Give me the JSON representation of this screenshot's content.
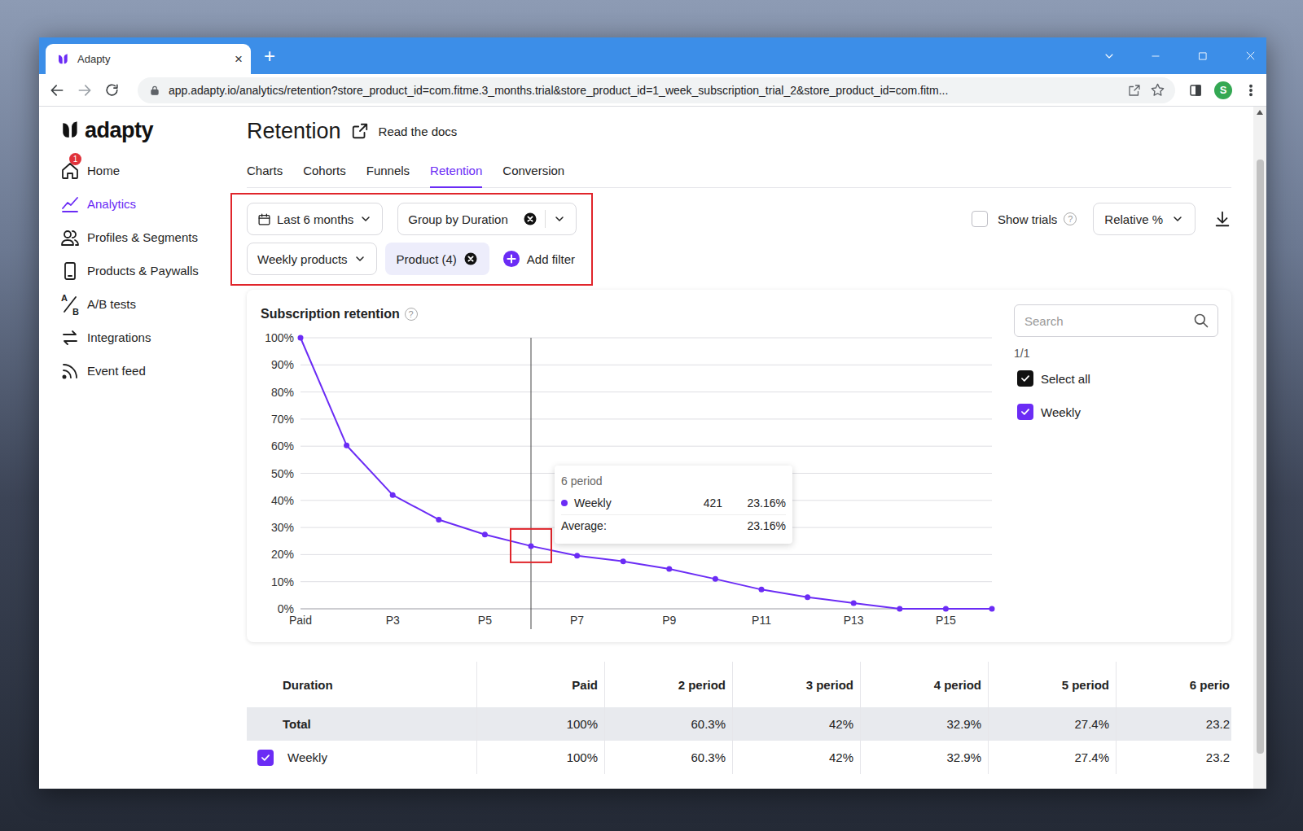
{
  "browser": {
    "tab_title": "Adapty",
    "tab_close": "×",
    "new_tab": "+",
    "url": "app.adapty.io/analytics/retention?store_product_id=com.fitme.3_months.trial&store_product_id=1_week_subscription_trial_2&store_product_id=com.fitm...",
    "profile": "S"
  },
  "sidebar": {
    "logo": "adapty",
    "items": [
      {
        "label": "Home",
        "selected": false,
        "badge": "1"
      },
      {
        "label": "Analytics",
        "selected": true
      },
      {
        "label": "Profiles & Segments",
        "selected": false
      },
      {
        "label": "Products & Paywalls",
        "selected": false
      },
      {
        "label": "A/B tests",
        "selected": false,
        "icon_letters": [
          "A",
          "B"
        ]
      },
      {
        "label": "Integrations",
        "selected": false
      },
      {
        "label": "Event feed",
        "selected": false
      }
    ]
  },
  "page": {
    "title": "Retention",
    "docs_link": "Read the docs"
  },
  "tabs": [
    {
      "label": "Charts",
      "selected": false
    },
    {
      "label": "Cohorts",
      "selected": false
    },
    {
      "label": "Funnels",
      "selected": false
    },
    {
      "label": "Retention",
      "selected": true
    },
    {
      "label": "Conversion",
      "selected": false
    }
  ],
  "filters": {
    "period": "Last 6 months",
    "group_by": "Group by Duration",
    "product_set": "Weekly products",
    "product_filter": "Product (4)",
    "add_filter": "Add filter",
    "show_trials": {
      "label": "Show trials",
      "checked": false,
      "help": "?"
    },
    "mode": "Relative %"
  },
  "chart": {
    "title": "Subscription retention",
    "help": "?",
    "y_ticks": [
      "100%",
      "90%",
      "80%",
      "70%",
      "60%",
      "50%",
      "40%",
      "30%",
      "20%",
      "10%",
      "0%"
    ],
    "x_labels": [
      "Paid",
      "P3",
      "P5",
      "P7",
      "P9",
      "P11",
      "P13",
      "P15"
    ],
    "series": [
      {
        "name": "Weekly",
        "color": "#6b2cf5",
        "values": [
          100,
          60.3,
          42,
          32.9,
          27.4,
          23.16,
          19.6,
          17.5,
          14.7,
          11.0,
          7.1,
          4.3,
          2.1,
          0,
          0,
          0
        ]
      }
    ],
    "hovered_point": 5,
    "tooltip": {
      "period": "6 period",
      "series": "Weekly",
      "count": "421",
      "value": "23.16%",
      "average_label": "Average:",
      "average": "23.16%"
    }
  },
  "legend": {
    "search_placeholder": "Search",
    "count": "1/1",
    "items": [
      {
        "label": "Select all",
        "checked": true,
        "kind": "all"
      },
      {
        "label": "Weekly",
        "checked": true,
        "kind": "series"
      }
    ]
  },
  "table": {
    "columns": [
      "Duration",
      "Paid",
      "2 period",
      "3 period",
      "4 period",
      "5 period",
      "6 perio"
    ],
    "rows": [
      {
        "label": "Total",
        "kind": "total",
        "cells": [
          "100%",
          "60.3%",
          "42%",
          "32.9%",
          "27.4%",
          "23.2"
        ]
      },
      {
        "label": "Weekly",
        "kind": "series",
        "checked": true,
        "cells": [
          "100%",
          "60.3%",
          "42%",
          "32.9%",
          "27.4%",
          "23.2"
        ]
      }
    ]
  }
}
